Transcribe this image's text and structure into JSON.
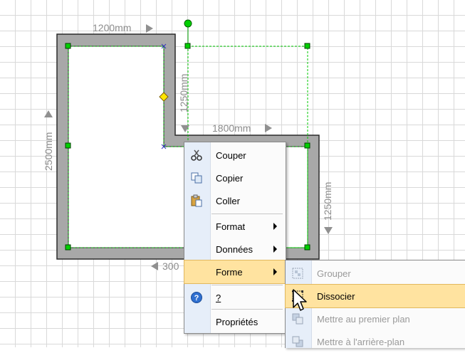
{
  "dimensions": {
    "top_width": "1200mm",
    "notch_depth": "1250mm",
    "step_width": "1800mm",
    "left_height": "2500mm",
    "right_height": "1250mm",
    "bottom_width": "300"
  },
  "context_menu": {
    "items": [
      {
        "label": "Couper",
        "accel": "C",
        "icon": "scissors-icon"
      },
      {
        "label": "Copier",
        "accel": "p",
        "icon": "copy-icon"
      },
      {
        "label": "Coller",
        "accel": "o",
        "icon": "paste-icon"
      },
      {
        "label": "Format",
        "accel": "m",
        "submenu": true
      },
      {
        "label": "Données",
        "accel": "D",
        "submenu": true
      },
      {
        "label": "Forme",
        "accel": "e",
        "submenu": true,
        "selected": true
      },
      {
        "label": "?",
        "accel": "?",
        "icon": "help-icon"
      },
      {
        "label": "Propriétés",
        "accel": "r"
      }
    ]
  },
  "submenu": {
    "items": [
      {
        "label": "Grouper",
        "accel": "G",
        "icon": "group-icon",
        "enabled": false
      },
      {
        "label": "Dissocier",
        "accel": "D",
        "icon": "ungroup-icon",
        "enabled": true,
        "selected": true
      },
      {
        "label": "Mettre au premier plan",
        "accel": "i",
        "icon": "bring-front-icon",
        "enabled": false
      },
      {
        "label": "Mettre à l'arrière-plan",
        "icon": "send-back-icon",
        "enabled": false
      }
    ]
  },
  "colors": {
    "wall": "#a8a8a8",
    "selection_handle": "#00c800",
    "highlight": "#ffe3a0"
  }
}
